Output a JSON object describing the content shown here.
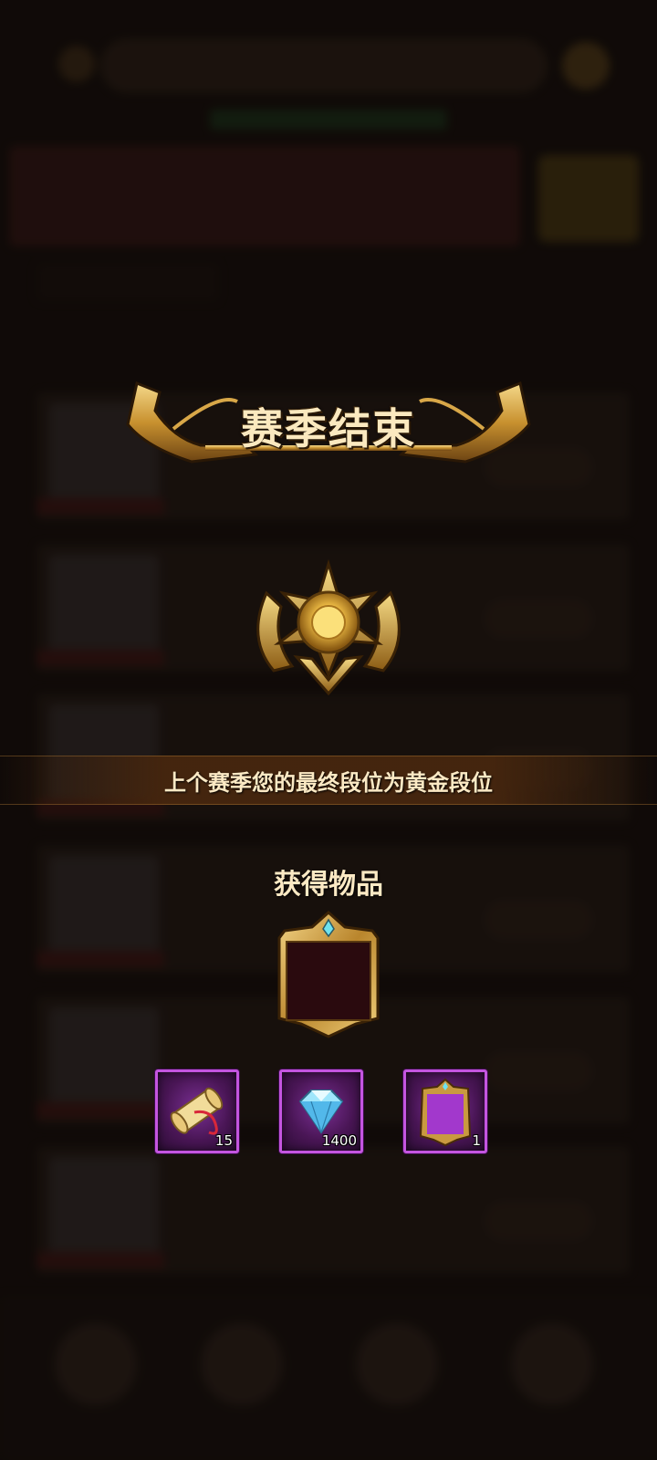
{
  "popup": {
    "title": "赛季结束",
    "rank_message": "上个赛季您的最终段位为黄金段位",
    "items_title": "获得物品"
  },
  "rewards": [
    {
      "icon": "scroll-icon",
      "quantity": "15"
    },
    {
      "icon": "diamond-icon",
      "quantity": "1400"
    },
    {
      "icon": "avatar-frame-icon",
      "quantity": "1"
    }
  ],
  "colors": {
    "gold": "#e6b94a",
    "item_border": "#c455e0",
    "text": "#fbe9c4"
  }
}
